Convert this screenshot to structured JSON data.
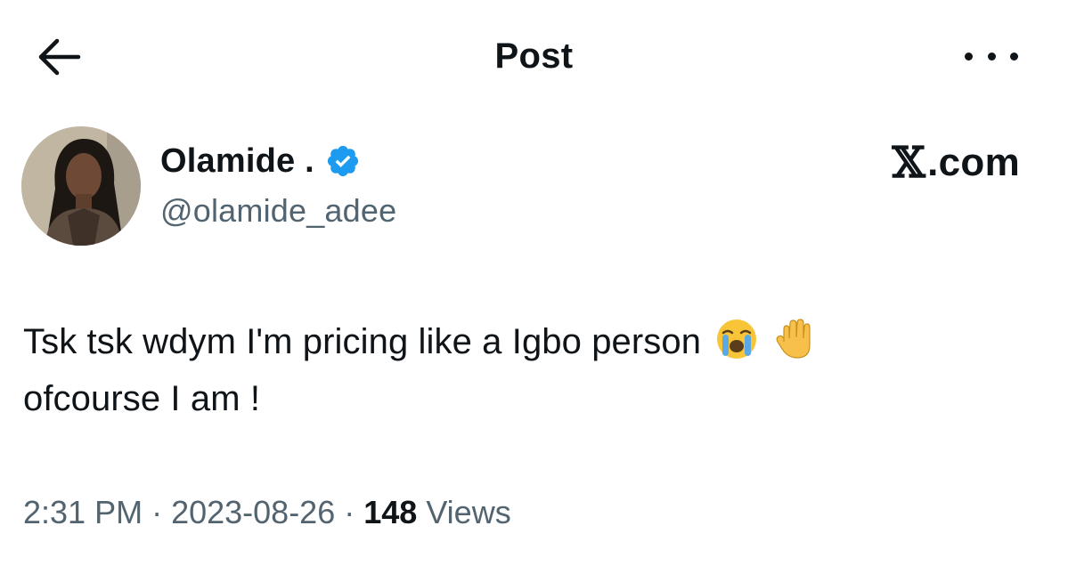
{
  "header": {
    "title": "Post",
    "back_icon": "arrow-left-icon",
    "more_icon": "more-dots-icon"
  },
  "author": {
    "name": "Olamide .",
    "handle": "@olamide_adee",
    "verified": true,
    "verified_color": "#1d9bf0",
    "avatar_icon": "profile-photo"
  },
  "watermark": {
    "x_glyph": "𝕏",
    "suffix": ".com"
  },
  "post": {
    "line1": "Tsk tsk wdym I'm pricing like a Igbo person",
    "line2": "ofcourse I am !",
    "emojis": [
      "loudly-crying-face",
      "raised-hand"
    ]
  },
  "meta": {
    "time": "2:31 PM",
    "separator": "·",
    "date": "2023-08-26",
    "views_count": "148",
    "views_label": "Views"
  },
  "colors": {
    "text": "#0f1419",
    "secondary_text": "#536471",
    "accent": "#1d9bf0"
  }
}
